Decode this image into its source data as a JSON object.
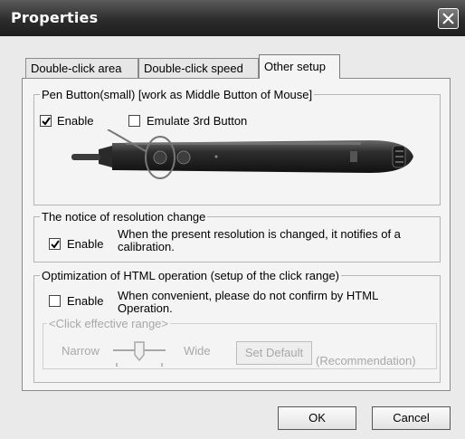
{
  "window": {
    "title": "Properties"
  },
  "tabs": [
    {
      "label": "Double-click area",
      "active": false
    },
    {
      "label": "Double-click speed",
      "active": false
    },
    {
      "label": "Other setup",
      "active": true
    }
  ],
  "pen_button": {
    "legend": "Pen Button(small)  [work as Middle Button of Mouse]",
    "enable_label": "Enable",
    "enable_checked": true,
    "emulate_label": "Emulate 3rd Button",
    "emulate_checked": false
  },
  "resolution": {
    "legend": "The notice of resolution change",
    "enable_label": "Enable",
    "enable_checked": true,
    "description": "When the present resolution is changed, it notifies of a calibration."
  },
  "html_opt": {
    "legend": "Optimization of HTML operation (setup of the click range)",
    "enable_label": "Enable",
    "enable_checked": false,
    "description": "When convenient, please do not confirm by HTML Operation.",
    "range_legend": "<Click effective range>",
    "narrow_label": "Narrow",
    "wide_label": "Wide",
    "set_default_label": "Set Default",
    "recommendation_label": "(Recommendation)",
    "slider_level": 0.5
  },
  "buttons": {
    "ok": "OK",
    "cancel": "Cancel"
  },
  "colors": {
    "titlebar": "#2c2c2c",
    "dialog_bg": "#eaeaea",
    "panel_bg": "#f4f4f4",
    "disabled_text": "#a8a8a8"
  }
}
